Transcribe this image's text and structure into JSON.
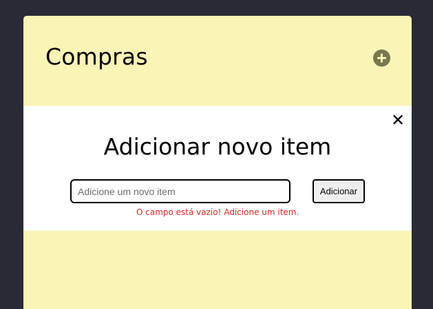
{
  "colors": {
    "background": "#282a36",
    "card": "#faf4b6",
    "add_button": "#78784f",
    "modal": "#ffffff",
    "error": "#e02424"
  },
  "card": {
    "title": "Compras",
    "add_icon": "plus-circle-icon"
  },
  "modal": {
    "close_icon": "close-icon",
    "close_glyph": "✕",
    "title": "Adicionar novo item",
    "input": {
      "placeholder": "Adicione um novo item",
      "value": ""
    },
    "submit_label": "Adicionar",
    "error_message": "O campo está vazio! Adicione um item."
  }
}
